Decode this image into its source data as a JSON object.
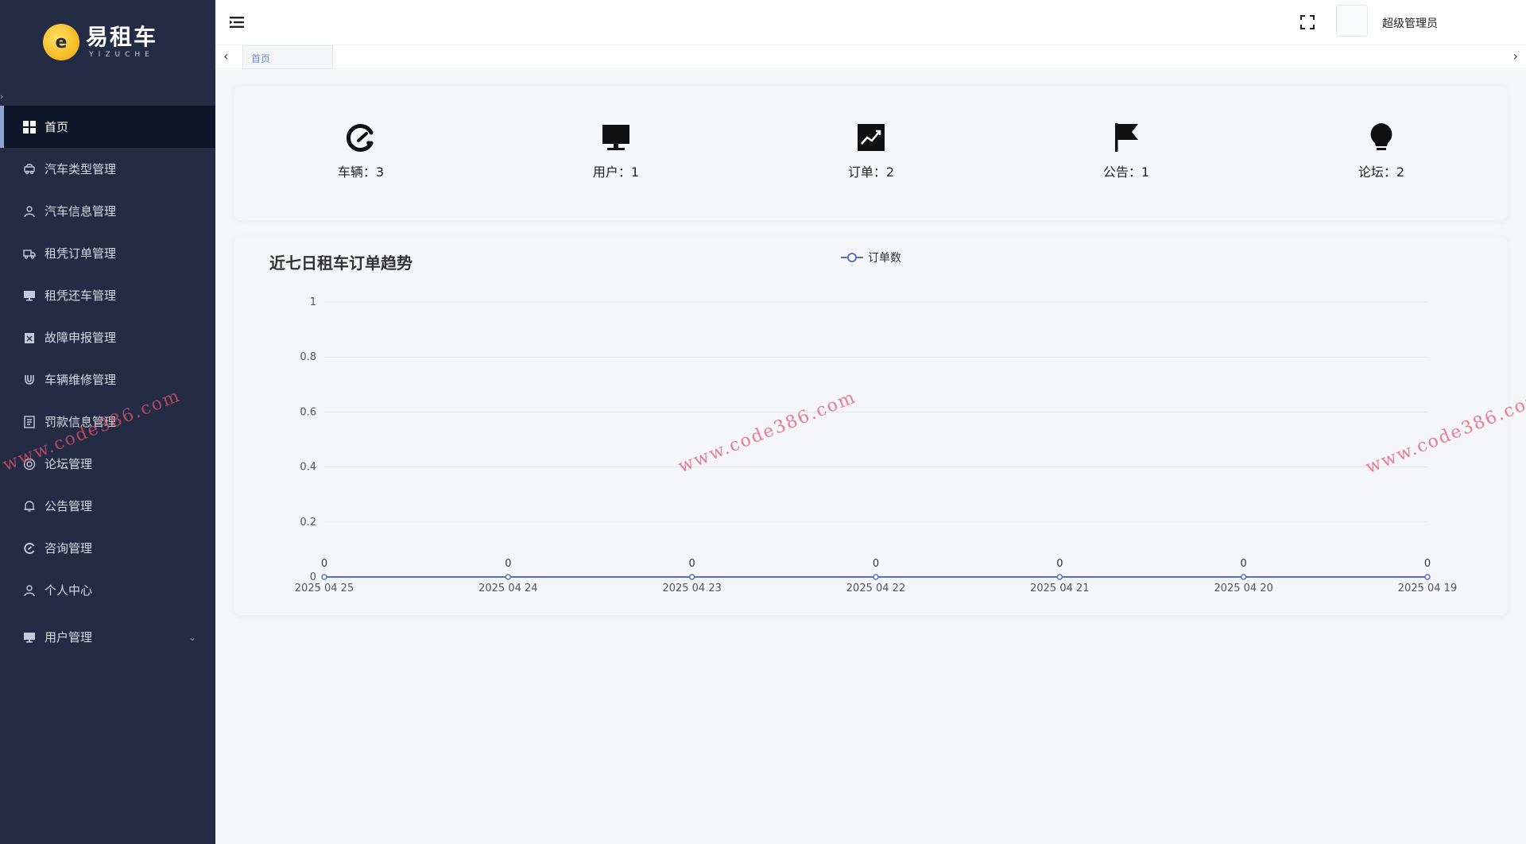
{
  "app": {
    "logo_title": "易租车",
    "logo_subtitle": "YIZUCHE",
    "logo_mark": "e"
  },
  "sidebar": {
    "items": [
      {
        "label": "首页",
        "icon": "grid-icon",
        "active": true
      },
      {
        "label": "汽车类型管理",
        "icon": "car-type-icon"
      },
      {
        "label": "汽车信息管理",
        "icon": "user-pin-icon"
      },
      {
        "label": "租凭订单管理",
        "icon": "truck-icon"
      },
      {
        "label": "租凭还车管理",
        "icon": "monitor-icon"
      },
      {
        "label": "故障申报管理",
        "icon": "clipboard-x-icon"
      },
      {
        "label": "车辆维修管理",
        "icon": "magnet-icon"
      },
      {
        "label": "罚款信息管理",
        "icon": "document-icon"
      },
      {
        "label": "论坛管理",
        "icon": "lifebuoy-icon"
      },
      {
        "label": "公告管理",
        "icon": "bell-icon"
      },
      {
        "label": "咨询管理",
        "icon": "dial-icon"
      },
      {
        "label": "个人中心",
        "icon": "person-icon"
      },
      {
        "label": "用户管理",
        "icon": "monitor-icon",
        "has_submenu": true
      }
    ]
  },
  "header": {
    "user_name": "超级管理员"
  },
  "tabs": [
    {
      "label": "首页"
    }
  ],
  "stats": [
    {
      "label": "车辆：3",
      "icon": "dial-icon"
    },
    {
      "label": "用户：1",
      "icon": "monitor-icon"
    },
    {
      "label": "订单：2",
      "icon": "trend-chart-icon"
    },
    {
      "label": "公告：1",
      "icon": "flag-icon"
    },
    {
      "label": "论坛：2",
      "icon": "bulb-icon"
    }
  ],
  "chart": {
    "title": "近七日租车订单趋势"
  },
  "chart_data": {
    "type": "line",
    "title": "近七日租车订单趋势",
    "x": [
      "2025 04 25",
      "2025 04 24",
      "2025 04 23",
      "2025 04 22",
      "2025 04 21",
      "2025 04 20",
      "2025 04 19"
    ],
    "series": [
      {
        "name": "订单数",
        "values": [
          0,
          0,
          0,
          0,
          0,
          0,
          0
        ]
      }
    ],
    "yticks": [
      "0",
      "0.2",
      "0.4",
      "0.6",
      "0.8",
      "1"
    ],
    "ylim": [
      0,
      1
    ],
    "grid": true,
    "legend_position": "top-center",
    "show_point_labels": true,
    "color": "#5470c6"
  },
  "watermark": {
    "text": "www.code386.com"
  }
}
